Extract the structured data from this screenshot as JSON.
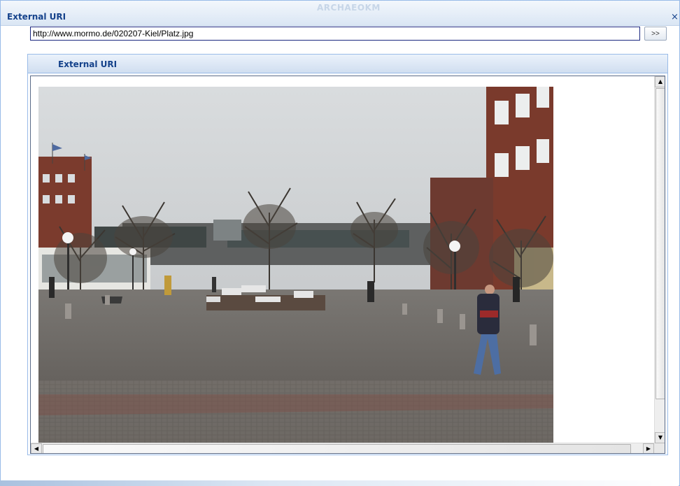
{
  "window": {
    "title": "External URI",
    "watermark": "ARCHAEOKM",
    "close_glyph": "×"
  },
  "url_bar": {
    "value": "http://www.mormo.de/020207-Kiel/Platz.jpg",
    "go_label": ">>"
  },
  "panel": {
    "title": "External URI"
  },
  "image": {
    "alt": "Platz.jpg",
    "sky_color": "#cfd3d6",
    "pavement_color": "#6d6a66",
    "building_color": "#7a3a2c"
  },
  "scrollbars": {
    "up_arrow": "▲",
    "down_arrow": "▼",
    "left_arrow": "◀",
    "right_arrow": "▶"
  }
}
